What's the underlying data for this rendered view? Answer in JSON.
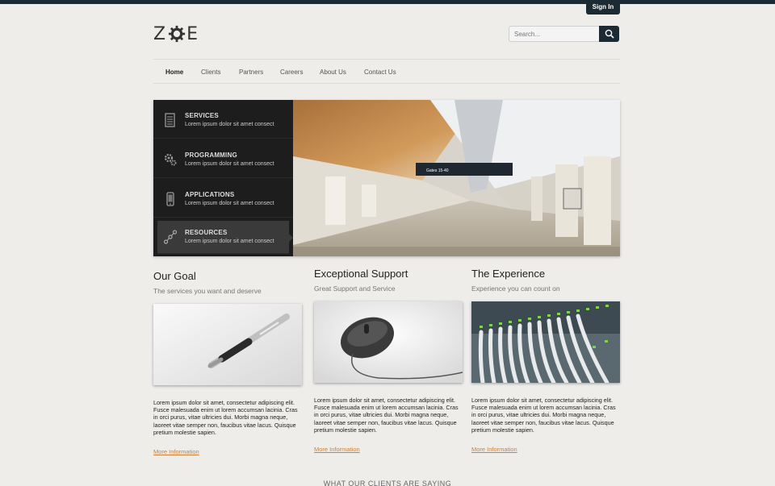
{
  "header": {
    "signin_label": "Sign In",
    "logo_text_left": "Z",
    "logo_text_right": "E",
    "search": {
      "placeholder": "Search..."
    }
  },
  "nav": {
    "items": [
      {
        "label": "Home",
        "active": true
      },
      {
        "label": "Clients"
      },
      {
        "label": "Partners"
      },
      {
        "label": "Careers"
      },
      {
        "label": "About Us"
      },
      {
        "label": "Contact Us"
      }
    ]
  },
  "hero": {
    "items": [
      {
        "title": "SERVICES",
        "subtitle": "Lorem ipsum dolor sit amet consect",
        "icon": "document-icon"
      },
      {
        "title": "PROGRAMMING",
        "subtitle": "Lorem ipsum dolor sit amet consect",
        "icon": "gears-icon"
      },
      {
        "title": "APPLICATIONS",
        "subtitle": "Lorem ipsum dolor sit amet consect",
        "icon": "phone-icon"
      },
      {
        "title": "RESOURCES",
        "subtitle": "Lorem ipsum dolor sit amet consect",
        "icon": "network-icon",
        "active": true
      }
    ],
    "sign_text": "Gates 15-40"
  },
  "columns": [
    {
      "title": "Our Goal",
      "subtitle": "The services you want and deserve",
      "image": "pen-photo",
      "body": "Lorem ipsum dolor sit amet, consectetur adipiscing elit. Fusce malesuada enim ut lorem accumsan lacinia. Cras in orci purus, vitae ultricies dui. Morbi magna neque, laoreet vitae semper non, faucibus vitae lacus. Quisque pretium molestie sapien.",
      "link": "More Information"
    },
    {
      "title": "Exceptional Support",
      "subtitle": "Great Support and Service",
      "image": "mouse-photo",
      "body": "Lorem ipsum dolor sit amet, consectetur adipiscing elit. Fusce malesuada enim ut lorem accumsan lacinia. Cras in orci purus, vitae ultricies dui. Morbi magna neque, laoreet vitae semper non, faucibus vitae lacus. Quisque pretium molestie sapien.",
      "link": "More Information"
    },
    {
      "title": "The Experience",
      "subtitle": "Experience you can count on",
      "image": "network-cables-photo",
      "body": "Lorem ipsum dolor sit amet, consectetur adipiscing elit. Fusce malesuada enim ut lorem accumsan lacinia. Cras in orci purus, vitae ultricies dui. Morbi magna neque, laoreet vitae semper non, faucibus vitae lacus. Quisque pretium molestie sapien.",
      "link": "More Information"
    }
  ],
  "clients_heading": "WHAT OUR CLIENTS ARE SAYING",
  "colors": {
    "dark": "#1c2b33",
    "accent": "#c8803c",
    "background": "#efedea"
  }
}
